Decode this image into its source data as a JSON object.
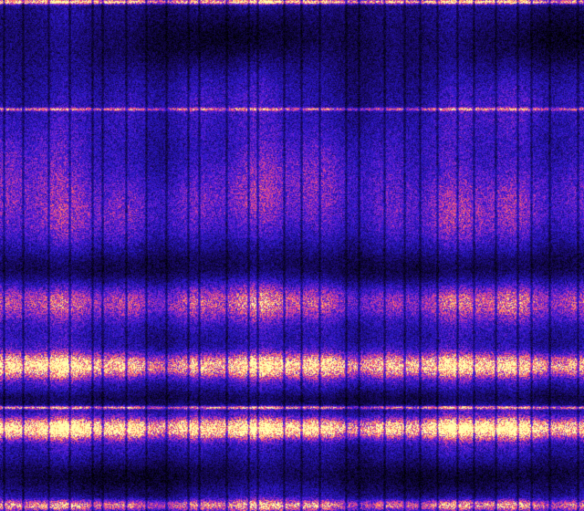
{
  "image": {
    "kind": "spectrogram",
    "colormap": [
      "#000000",
      "#1a0a6e",
      "#2a18c8",
      "#6a1fd8",
      "#c23aa8",
      "#ff5f6e",
      "#ffc46a",
      "#ffffb0"
    ],
    "background_color": "#0a0730",
    "bands": [
      {
        "position": 0.003,
        "width": 0.004,
        "intensity": 0.95
      },
      {
        "position": 0.213,
        "width": 0.003,
        "intensity": 0.55
      },
      {
        "position": 0.4,
        "width": 0.09,
        "intensity": 0.22
      },
      {
        "position": 0.59,
        "width": 0.035,
        "intensity": 0.45
      },
      {
        "position": 0.715,
        "width": 0.022,
        "intensity": 0.85
      },
      {
        "position": 0.797,
        "width": 0.003,
        "intensity": 0.7
      },
      {
        "position": 0.838,
        "width": 0.018,
        "intensity": 1.0
      },
      {
        "position": 0.988,
        "width": 0.01,
        "intensity": 0.6
      }
    ],
    "dark_regions": [
      {
        "position": 0.08,
        "width": 0.08,
        "depth": 0.55
      },
      {
        "position": 0.52,
        "width": 0.05,
        "depth": 0.45
      },
      {
        "position": 0.78,
        "width": 0.02,
        "depth": 0.5
      },
      {
        "position": 0.93,
        "width": 0.04,
        "depth": 0.6
      }
    ],
    "column_stripe_count": 30,
    "has_text": false
  }
}
